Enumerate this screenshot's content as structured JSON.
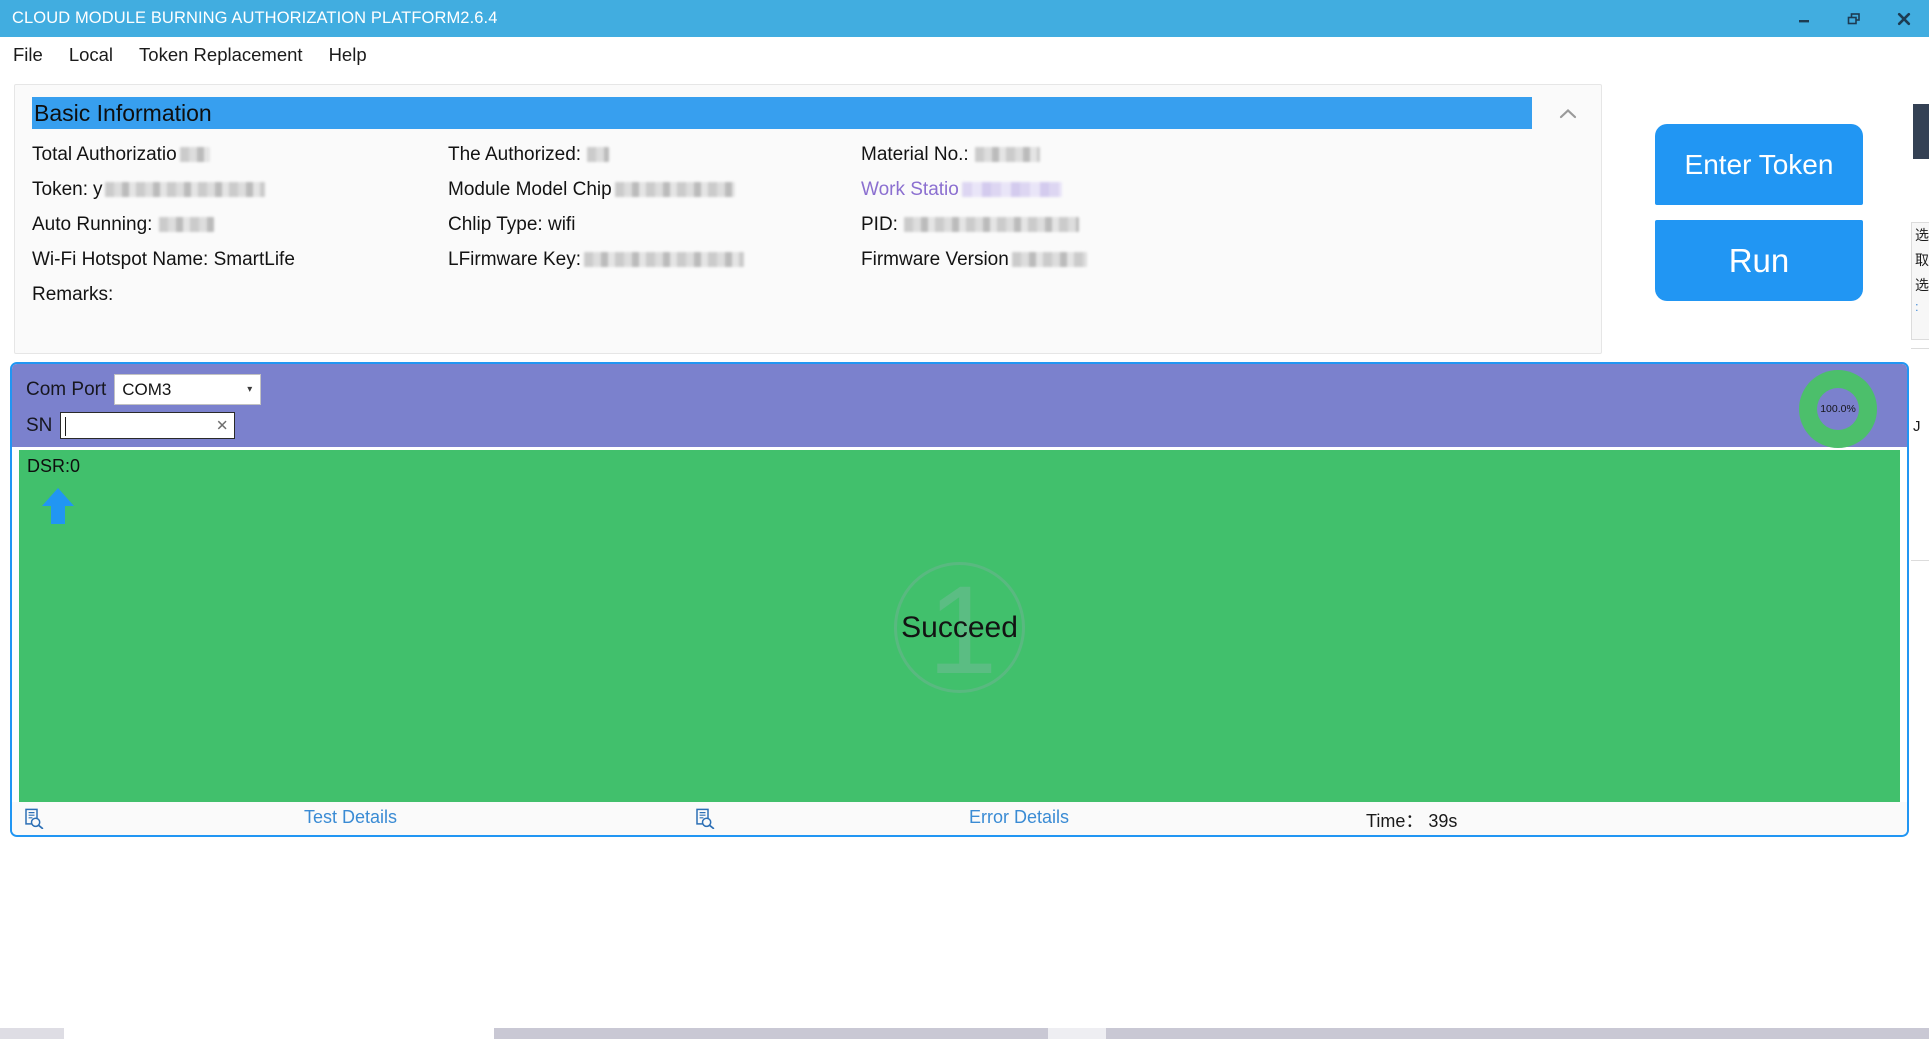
{
  "window": {
    "title": "CLOUD MODULE BURNING AUTHORIZATION PLATFORM2.6.4",
    "controls": {
      "minimize": "minimize-icon",
      "restore": "restore-icon",
      "close": "close-icon"
    },
    "accent_color": "#41ade0"
  },
  "menu": {
    "items": [
      {
        "label": "File"
      },
      {
        "label": "Local"
      },
      {
        "label": "Token Replacement"
      },
      {
        "label": "Help"
      }
    ]
  },
  "basic_information": {
    "header": "Basic Information",
    "header_color": "#379fef",
    "collapse_icon": "chevron-up-icon",
    "column_1": [
      {
        "label": "Total Authorizatio",
        "value": "",
        "redacted": true
      },
      {
        "label": "Token:",
        "value": "y",
        "redacted": true
      },
      {
        "label": "Auto Running:",
        "value": "",
        "redacted": true
      },
      {
        "label": "Wi-Fi Hotspot Name: SmartLife",
        "value": "",
        "redacted": false
      },
      {
        "label": "Remarks:",
        "value": "",
        "redacted": false
      }
    ],
    "column_2": [
      {
        "label": "The Authorized:",
        "value": "",
        "redacted": true
      },
      {
        "label": "Module Model Chip",
        "value": "",
        "redacted": true
      },
      {
        "label": "Chlip Type: wifi",
        "value": "",
        "redacted": false
      },
      {
        "label": "LFirmware Key:",
        "value": "",
        "redacted": true
      }
    ],
    "column_3": [
      {
        "label": "Material No.:",
        "value": "",
        "redacted": true
      },
      {
        "label": "Work Statio",
        "value": "",
        "redacted": true,
        "link": true
      },
      {
        "label": "PID:",
        "value": "",
        "redacted": true
      },
      {
        "label": "Firmware Version",
        "value": "",
        "redacted": true
      }
    ]
  },
  "actions": {
    "enter_token": "Enter Token",
    "run": "Run",
    "button_color": "#2196f3"
  },
  "edge_panel": {
    "items": [
      "选",
      "取",
      "选"
    ],
    "dots": ":",
    "j_text": "J"
  },
  "operation": {
    "com_port": {
      "label": "Com Port",
      "value": "COM3",
      "options": [
        "COM3"
      ],
      "arrow_icon": "chevron-down-icon"
    },
    "sn": {
      "label": "SN",
      "value": "",
      "placeholder": "",
      "clear_icon": "clear-x-icon"
    },
    "progress": {
      "percent": "100.0%",
      "ring_color": "#4cbf6b",
      "track_color": "#7b81cd"
    },
    "panel_bg": "#7b81cd",
    "result_bg": "#41c06c",
    "dsr": "DSR:0",
    "arrow_icon": "up-arrow-icon",
    "result": {
      "badge_number": "1",
      "label": "Succeed"
    },
    "status_bar": {
      "test_details_icon": "document-search-icon",
      "test_details": "Test Details",
      "error_details_icon": "document-search-icon",
      "error_details": "Error Details",
      "time": "Time： 39s"
    }
  }
}
